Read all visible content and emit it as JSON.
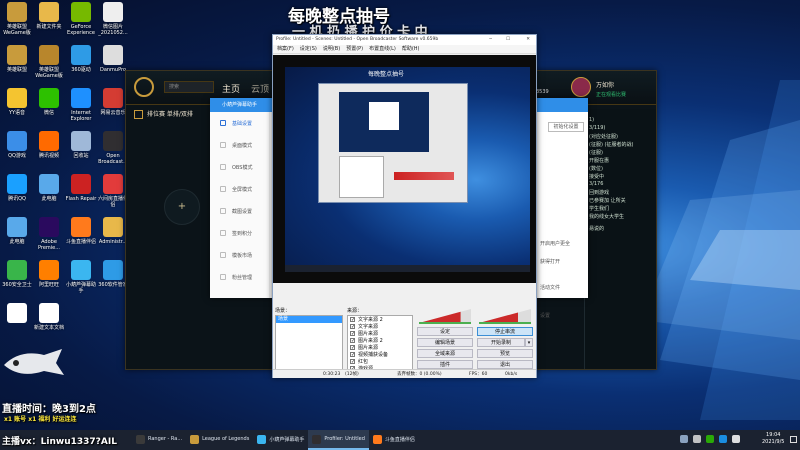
{
  "desktop": {
    "icons": [
      {
        "label": "英雄联盟WeGame版",
        "icon": "lol-icon",
        "color": "#c89b3c"
      },
      {
        "label": "新建文件夹",
        "icon": "folder-icon",
        "color": "#e8b84a"
      },
      {
        "label": "GeForce Experience",
        "icon": "nvidia-icon",
        "color": "#76b900"
      },
      {
        "label": "微信图片_2021052...",
        "icon": "image-file-icon",
        "color": "#eeeeee"
      },
      {
        "label": "英雄联盟",
        "icon": "lol-icon",
        "color": "#c89b3c"
      },
      {
        "label": "英雄联盟WeGame版",
        "icon": "lol-icon",
        "color": "#b8862c"
      },
      {
        "label": "360驱动",
        "icon": "driver-icon",
        "color": "#2e9be6"
      },
      {
        "label": "DanmuPro",
        "icon": "danmu-icon",
        "color": "#dddddd"
      },
      {
        "label": "YY语音",
        "icon": "yy-icon",
        "color": "#f4c430"
      },
      {
        "label": "微信",
        "icon": "wechat-icon",
        "color": "#2dc100"
      },
      {
        "label": "Internet Explorer",
        "icon": "ie-icon",
        "color": "#1e90ff"
      },
      {
        "label": "网易云音乐",
        "icon": "netease-music-icon",
        "color": "#d43c33"
      },
      {
        "label": "QQ游戏",
        "icon": "qqgame-icon",
        "color": "#3b8ee8"
      },
      {
        "label": "腾讯视频",
        "icon": "tencent-video-icon",
        "color": "#ff6a00"
      },
      {
        "label": "回收站",
        "icon": "recycle-bin-icon",
        "color": "#9fb8d8"
      },
      {
        "label": "Open Broadcast...",
        "icon": "obs-icon",
        "color": "#302e31"
      },
      {
        "label": "腾讯QQ",
        "icon": "qq-icon",
        "color": "#1aa0ff"
      },
      {
        "label": "此电脑",
        "icon": "computer-icon",
        "color": "#59a9ea"
      },
      {
        "label": "Flash Repair",
        "icon": "flash-repair-icon",
        "color": "#cc2222"
      },
      {
        "label": "六间房直播伴侣",
        "icon": "6rooms-icon",
        "color": "#e23b3b"
      },
      {
        "label": "此电脑",
        "icon": "computer-icon",
        "color": "#59a9ea"
      },
      {
        "label": "Adobe Premie...",
        "icon": "premiere-icon",
        "color": "#2a0a5e"
      },
      {
        "label": "斗鱼直播伴侣",
        "icon": "douyu-icon",
        "color": "#ff7a1c"
      },
      {
        "label": "Administr...",
        "icon": "user-folder-icon",
        "color": "#e8b84a"
      },
      {
        "label": "360安全卫士",
        "icon": "360-security-icon",
        "color": "#39b54a"
      },
      {
        "label": "阿里旺旺",
        "icon": "aliwangwang-icon",
        "color": "#ff7f00"
      },
      {
        "label": "小葫芦弹幕助手",
        "icon": "xiaohulu-icon",
        "color": "#3bb6f0"
      },
      {
        "label": "360软件管家",
        "icon": "360-store-icon",
        "color": "#2e9be6"
      },
      {
        "label": "",
        "icon": "douyu-logo-icon",
        "color": "#ffffff"
      },
      {
        "label": "新建文本文档",
        "icon": "text-file-icon",
        "color": "#ffffff"
      }
    ]
  },
  "overlays": {
    "top_line1": "每晚整点抽号",
    "top_line2": "一 机 扔 播 护 价 卡 中",
    "time_text": "直播时间：晚3到2点",
    "wx_text": "主播vx：Linwu1337?AIL",
    "lucky_text": "x1 账号 x1 福利 好运连连"
  },
  "lol_client": {
    "nav_home": "主页",
    "nav_cloud": "云顶",
    "search_placeholder": "搜索",
    "mode_label": "排位赛 单排/双排",
    "player_name": "万如你",
    "player_status": "正在观看比赛",
    "level_fragment": "3539",
    "chat_lines": [
      "1)",
      "3/119)",
      "(对应处征服)",
      "(征服) (征服者的战)",
      "(征服)",
      "开服在惠",
      "(数位)",
      "接受中",
      "3/176",
      "回到游戏",
      "已参赛加 让所关",
      "学生我们",
      "我的线女大学生"
    ],
    "chat_user": "易说的",
    "plus": "+"
  },
  "xiaohulu": {
    "title": "小葫芦弹幕助手",
    "menu": [
      "基础设置",
      "桌面模式",
      "OBS模式",
      "全屏模式",
      "截图设置",
      "签到积分",
      "模板市场",
      "粉丝管理"
    ],
    "right_btn1": "初始化设置",
    "right_btn2": "设置",
    "note1": "开启用户更全",
    "note2": "获得打开",
    "note3": "活动文件"
  },
  "obs": {
    "title": "Profile: Untitled - Scenes: Untitled - Open Broadcaster Software v0.659b",
    "menu": [
      "档案(F)",
      "设定(S)",
      "说明(B)",
      "预置(P)",
      "布置直线(L)",
      "帮助(H)"
    ],
    "preview_banner": "每晚整点抽号",
    "scenes_header": "场景：",
    "scene_item": "场景",
    "sources_header": "来源：",
    "sources": [
      {
        "name": "文字来源 2",
        "checked": true
      },
      {
        "name": "文字来源",
        "checked": true
      },
      {
        "name": "图片来源",
        "checked": true
      },
      {
        "name": "图片来源 2",
        "checked": true
      },
      {
        "name": "图片来源",
        "checked": true
      },
      {
        "name": "视频捕获设备",
        "checked": true
      },
      {
        "name": "红包",
        "checked": true
      },
      {
        "name": "游戏源",
        "checked": true
      }
    ],
    "buttons": {
      "settings": "设定",
      "stop_stream": "停止串流",
      "edit_scene": "编辑场景",
      "start_record": "开始录制",
      "global_sources": "全域来源",
      "preview": "预览",
      "plugins": "插件",
      "exit": "退出"
    },
    "status": {
      "time": "0:30:23",
      "time_sub": "(12帧)",
      "dropped": "丢弃帧数：0 (0.00%)",
      "fps": "FPS：60",
      "bitrate": "0kb/s"
    },
    "audio_levels": [
      0.8,
      0.75
    ]
  },
  "taskbar": {
    "items": [
      {
        "label": "Ranger - Ra...",
        "color": "#3a3a3a",
        "active": false
      },
      {
        "label": "League of Legends",
        "color": "#c89b3c",
        "active": false
      },
      {
        "label": "小葫芦弹幕助手",
        "color": "#3bb6f0",
        "active": false
      },
      {
        "label": "Profiler: Untitled",
        "color": "#302e31",
        "active": true
      },
      {
        "label": "斗鱼直播伴侣",
        "color": "#ff7a1c",
        "active": false
      }
    ],
    "time": "19:04",
    "date": "2021/9/5",
    "tray_icons": [
      "network-icon",
      "volume-icon",
      "wechat-tray-icon",
      "qq-tray-icon",
      "ime-icon"
    ]
  },
  "colors": {
    "accent_blue": "#2b6fd6",
    "douyu_orange": "#ff7a1c",
    "obs_stop_btn": "#cce4f7"
  }
}
